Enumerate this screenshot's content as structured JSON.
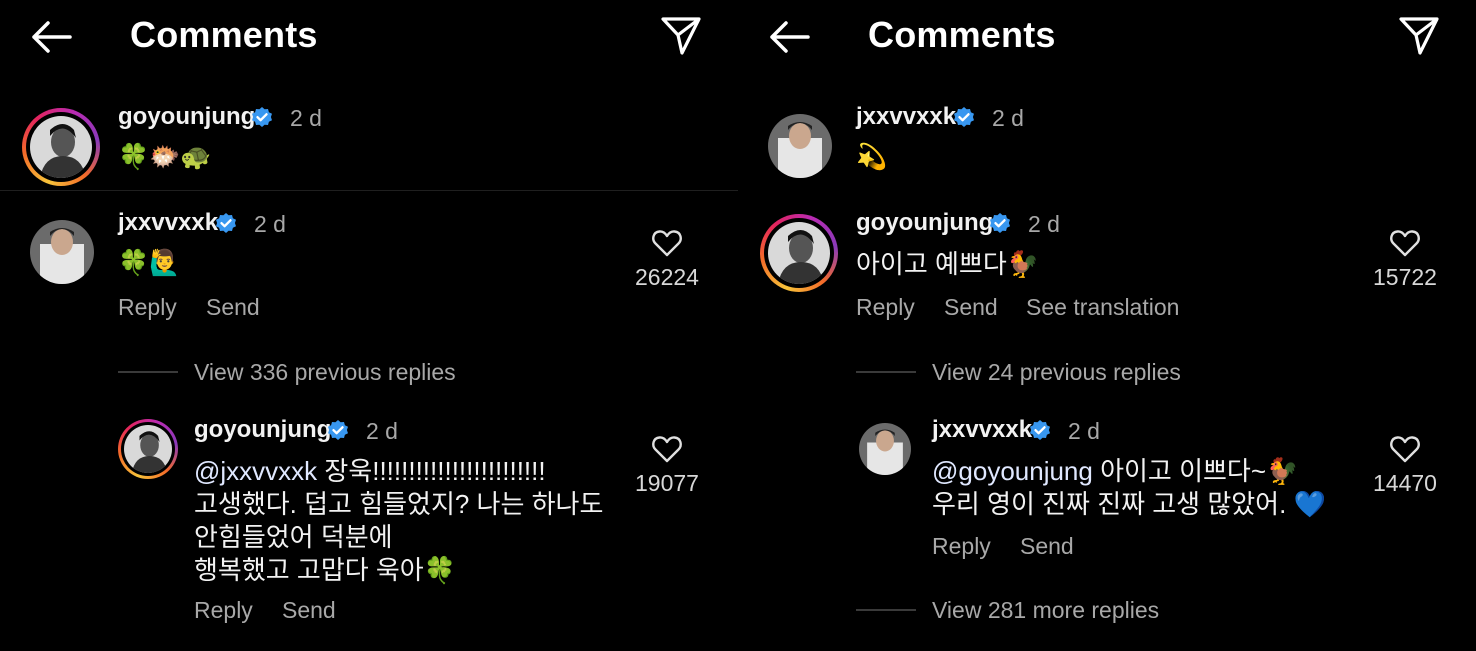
{
  "screens": [
    {
      "title": "Comments",
      "top_comment": {
        "username": "goyounjung",
        "time": "2 d",
        "text": "🍀🐡🐢"
      },
      "comment": {
        "username": "jxxvvxxk",
        "time": "2 d",
        "text": "🍀🙋‍♂️",
        "likes": "26224",
        "reply": "Reply",
        "send": "Send"
      },
      "view_previous": "View 336 previous replies",
      "reply": {
        "username": "goyounjung",
        "time": "2 d",
        "mention": "@jxxvvxxk",
        "line1_rest": " 장욱!!!!!!!!!!!!!!!!!!!!!!!!",
        "line2": "고생했다. 덥고 힘들었지? 나는 하나도",
        "line3": "안힘들었어 덕분에",
        "line4": "행복했고 고맙다 욱아🍀",
        "likes": "19077",
        "reply": "Reply",
        "send": "Send"
      }
    },
    {
      "title": "Comments",
      "top_comment": {
        "username": "jxxvvxxk",
        "time": "2 d",
        "text": "💫"
      },
      "comment": {
        "username": "goyounjung",
        "time": "2 d",
        "text": "아이고 예쁘다🐓",
        "likes": "15722",
        "reply": "Reply",
        "send": "Send",
        "translate": "See translation"
      },
      "view_previous": "View 24 previous replies",
      "reply": {
        "username": "jxxvvxxk",
        "time": "2 d",
        "mention": "@goyounjung",
        "line1_rest": " 아이고 이쁘다~🐓",
        "line2": "우리 영이 진짜 진짜 고생 많았어. 💙",
        "likes": "14470",
        "reply": "Reply",
        "send": "Send"
      },
      "view_more": "View 281 more replies"
    }
  ],
  "colors": {
    "background": "#000000",
    "verified": "#3897f0",
    "muted": "#a8a8a8"
  },
  "icons": [
    "back-arrow-icon",
    "share-paper-plane-icon",
    "verified-badge-icon",
    "heart-outline-icon"
  ]
}
